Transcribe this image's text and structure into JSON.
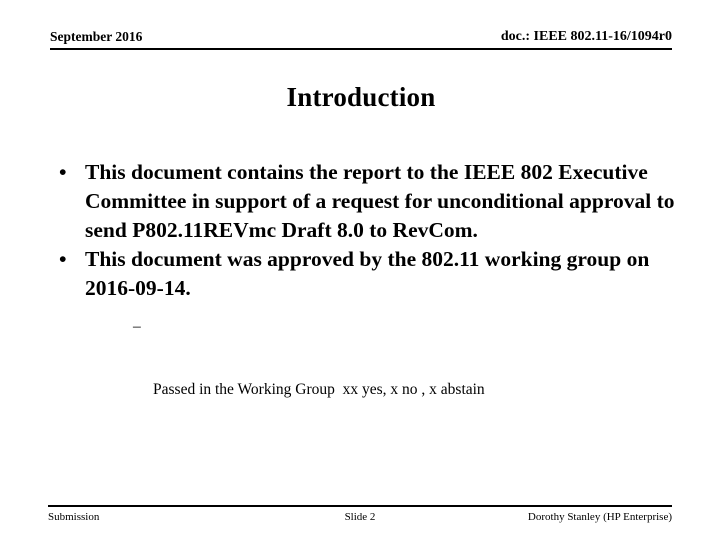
{
  "header": {
    "date": "September 2016",
    "doc_id": "doc.: IEEE 802.11-16/1094r0"
  },
  "title": "Introduction",
  "body": {
    "bullets": [
      {
        "marker": "•",
        "text": "This document contains the report to the IEEE 802 Executive Committee in support of a request for unconditional approval to send P802.11REVmc Draft 8.0 to RevCom.",
        "sub_bullets": []
      },
      {
        "marker": "•",
        "text": "This document was approved by the 802.11 working group on 2016-09-14.",
        "sub_bullets": [
          {
            "marker": "–",
            "text": "Passed in the Working Group  xx yes, x no , x abstain"
          }
        ]
      }
    ]
  },
  "footer": {
    "left": "Submission",
    "center": "Slide 2",
    "right": "Dorothy Stanley (HP Enterprise)"
  },
  "colors": {
    "text": "#000000",
    "background": "#ffffff",
    "rule": "#000000"
  }
}
